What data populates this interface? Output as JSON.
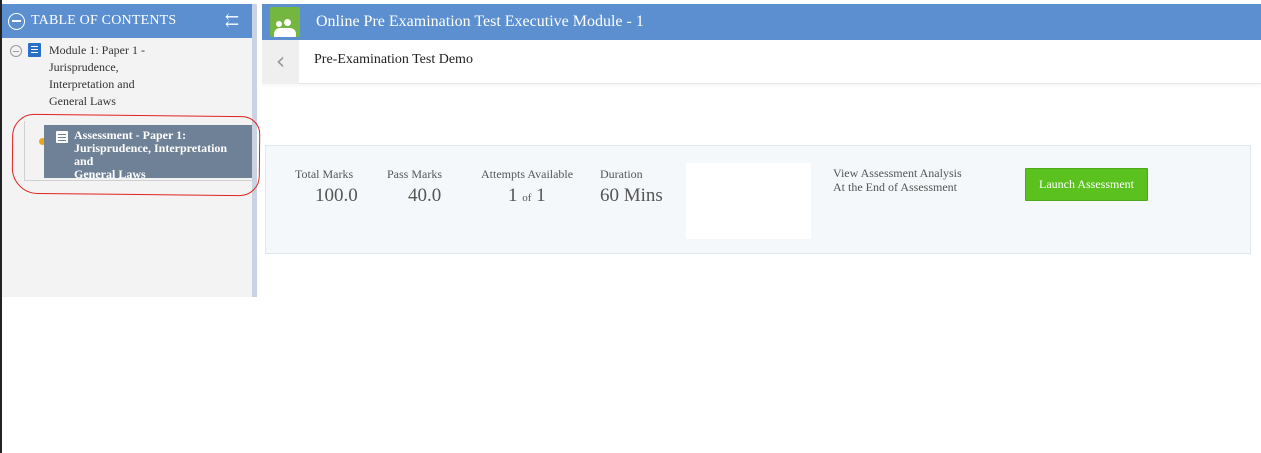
{
  "sidebar": {
    "header_title": "TABLE OF CONTENTS",
    "collapse_glyph": "⇇",
    "module": {
      "label_lines": [
        "Module 1: Paper 1 -",
        "Jurisprudence,",
        "Interpretation and",
        "General Laws"
      ]
    },
    "assessment_item": {
      "label_lines": [
        "Assessment - Paper 1:",
        "Jurisprudence, Interpretation and",
        "General Laws"
      ],
      "selected": true
    }
  },
  "topbar": {
    "course_title": "Online Pre Examination Test Executive Module - 1"
  },
  "subheader": {
    "back_glyph": "‹",
    "title": "Pre-Examination Test Demo"
  },
  "assessment": {
    "total_marks": {
      "label": "Total Marks",
      "value": "100.0"
    },
    "pass_marks": {
      "label": "Pass Marks",
      "value": "40.0"
    },
    "attempts": {
      "label": "Attempts Available",
      "used": "1",
      "of": "of",
      "total": "1"
    },
    "duration": {
      "label": "Duration",
      "value": "60 Mins"
    },
    "analysis_lines": [
      "View Assessment Analysis",
      "At the End of Assessment"
    ],
    "launch_label": "Launch Assessment"
  },
  "colors": {
    "header_blue": "#5b8fd0",
    "selected_item": "#6f8196",
    "launch_green": "#5bc11f",
    "annotation_red": "#e0221f",
    "bullet_orange": "#e7a91a"
  }
}
